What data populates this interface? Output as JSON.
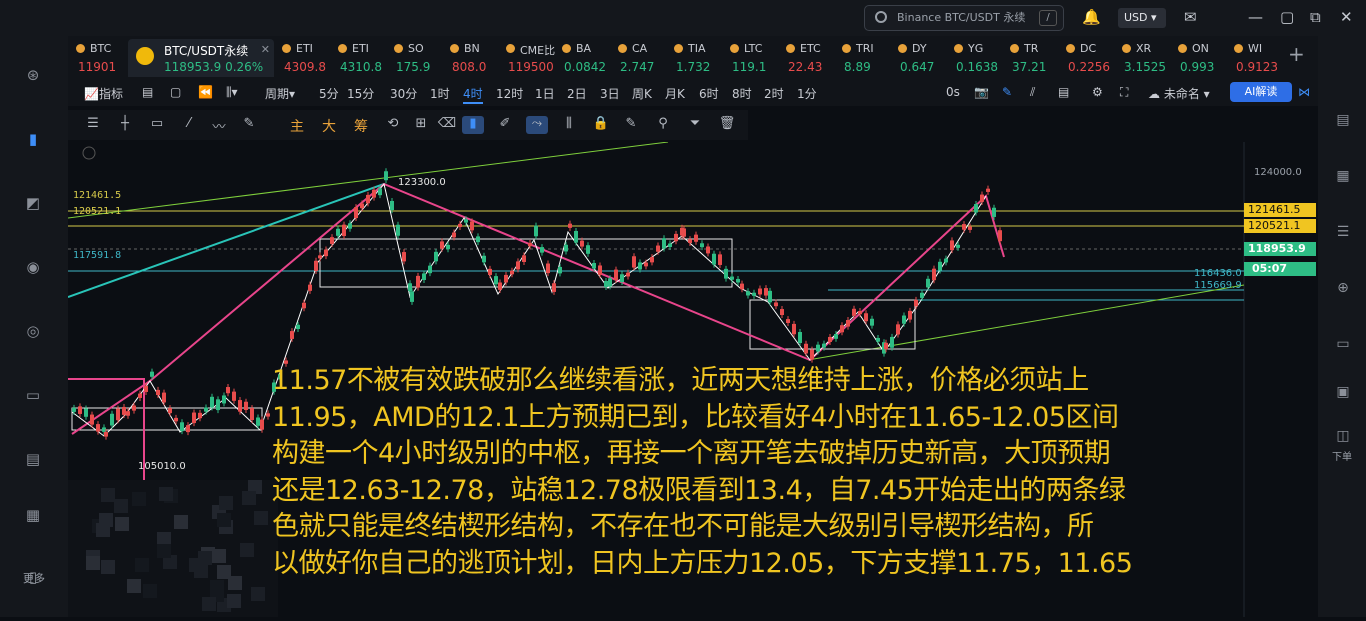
{
  "search": {
    "placeholder": "Binance BTC/USDT 永续",
    "shortcut": "/"
  },
  "currency": "USD",
  "sidebar_more": "更多",
  "right_download": "下单",
  "tabs": [
    {
      "name": "BTC",
      "price": "11901",
      "color": "#e84c4c"
    },
    {
      "name": "BTC/USDT永续",
      "price": "118953.9  0.26%",
      "color": "#2ebd85",
      "active": true
    },
    {
      "name": "ETI",
      "price": "4309.8",
      "color": "#e84c4c"
    },
    {
      "name": "ETI",
      "price": "4310.8",
      "color": "#2ebd85"
    },
    {
      "name": "SO",
      "price": "175.9",
      "color": "#2ebd85"
    },
    {
      "name": "BN",
      "price": "808.0",
      "color": "#e84c4c"
    },
    {
      "name": "CME比",
      "price": "119500",
      "color": "#e84c4c"
    },
    {
      "name": "BA",
      "price": "0.0842",
      "color": "#2ebd85"
    },
    {
      "name": "CA",
      "price": "2.747",
      "color": "#2ebd85"
    },
    {
      "name": "TIA",
      "price": "1.732",
      "color": "#2ebd85"
    },
    {
      "name": "LTC",
      "price": "119.1",
      "color": "#2ebd85"
    },
    {
      "name": "ETC",
      "price": "22.43",
      "color": "#e84c4c"
    },
    {
      "name": "TRI",
      "price": "8.89",
      "color": "#2ebd85"
    },
    {
      "name": "DY",
      "price": "0.647",
      "color": "#2ebd85"
    },
    {
      "name": "YG",
      "price": "0.1638",
      "color": "#2ebd85"
    },
    {
      "name": "TR",
      "price": "37.21",
      "color": "#2ebd85"
    },
    {
      "name": "DC",
      "price": "0.2256",
      "color": "#e84c4c"
    },
    {
      "name": "XR",
      "price": "3.1525",
      "color": "#2ebd85"
    },
    {
      "name": "ON",
      "price": "0.993",
      "color": "#2ebd85"
    },
    {
      "name": "WI",
      "price": "0.9123",
      "color": "#e84c4c"
    }
  ],
  "toolbar": {
    "indicator": "指标",
    "period": "周期",
    "intervals": [
      "5分",
      "15分",
      "30分",
      "1时",
      "4时",
      "12时",
      "1日",
      "2日",
      "3日",
      "周K",
      "月K",
      "6时",
      "8时",
      "2时",
      "1分"
    ],
    "selected_interval": "4时",
    "countdown_label": "0s",
    "unnamed": "未命名",
    "ai": "AI解读"
  },
  "draw_tools_cn": [
    "主",
    "大",
    "筹"
  ],
  "chart_labels": {
    "high": "123300.0",
    "low": "105010.0",
    "left_prices": [
      "121461.5",
      "120521.1",
      "117591.8"
    ],
    "right_lines": [
      "116436.0",
      "115669.9"
    ]
  },
  "price_axis": {
    "top": "124000.0",
    "p1": "121461.5",
    "p2": "120521.1",
    "current": "118953.9",
    "timer": "05:07"
  },
  "colors": {
    "up": "#2ebd85",
    "down": "#e84c4c",
    "accent": "#3e8ef7",
    "overlay_text": "#f0c521",
    "pink": "#e8458b"
  },
  "overlay_lines": [
    "11.57不被有效跌破那么继续看涨，近两天想维持上涨，价格必须站上",
    "11.95，AMD的12.1上方预期已到，比较看好4小时在11.65-12.05区间",
    "构建一个4小时级别的中枢，再接一个离开笔去破掉历史新高，大顶预期",
    "还是12.63-12.78，站稳12.78极限看到13.4，自7.45开始走出的两条绿",
    "色就只能是终结楔形结构，不存在也不可能是大级别引导楔形结构，所",
    "以做好你自己的逃顶计划，日内上方压力12.05，下方支撑11.75，11.65"
  ]
}
